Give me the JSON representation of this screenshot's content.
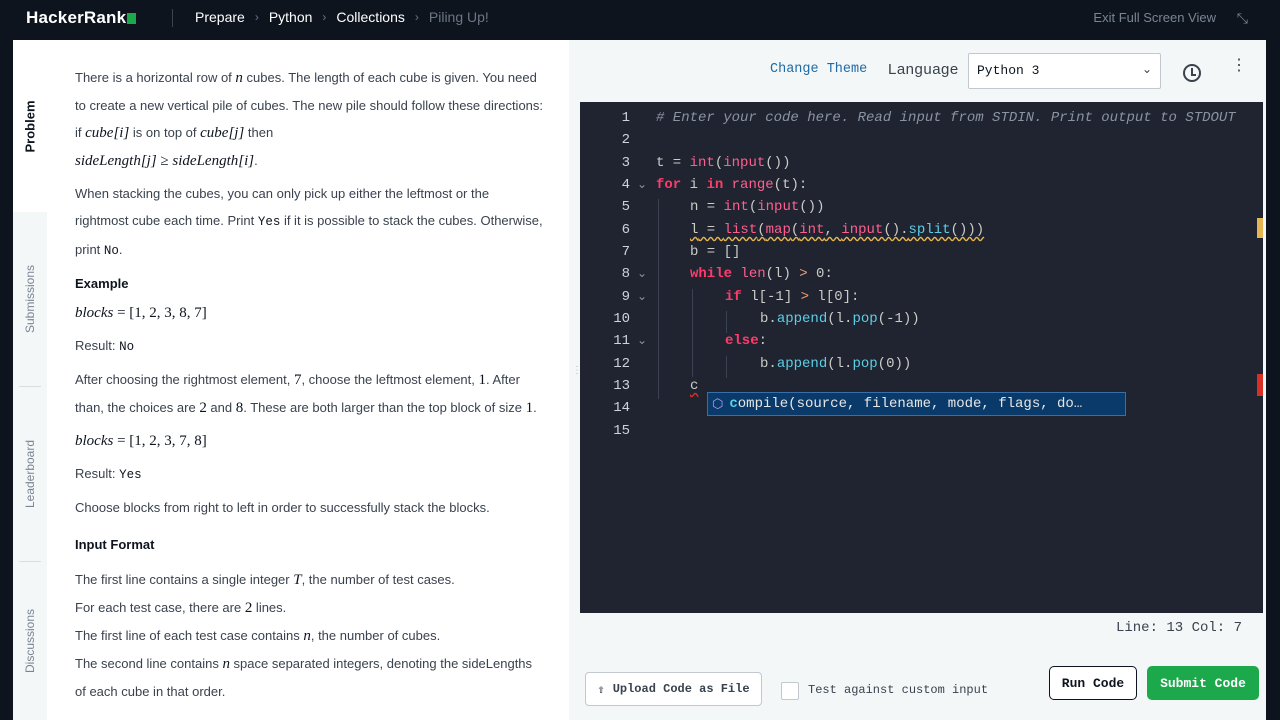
{
  "topbar": {
    "logo": "HackerRank",
    "breadcrumbs": [
      "Prepare",
      "Python",
      "Collections",
      "Piling Up!"
    ],
    "chev": "›",
    "exit_fullscreen": "Exit Full Screen View",
    "exit_icon": "⤡"
  },
  "side_tabs": [
    "Problem",
    "Submissions",
    "Leaderboard",
    "Discussions"
  ],
  "problem": {
    "p1a": "There is a horizontal row of ",
    "p1n": "n",
    "p1b": " cubes. The length of each cube is given. You need to create a new vertical pile of cubes. The new pile should follow these directions: if ",
    "p1c1": "cube[i]",
    "p1c": " is on top of ",
    "p1c2": "cube[j]",
    "p1d": " then",
    "p1math": "sideLength[j] ≥ sideLength[i]",
    "p1e": ".",
    "p2a": "When stacking the cubes, you can only pick up either the leftmost or the rightmost cube each time. Print ",
    "p2yes": "Yes",
    "p2b": " if it is possible to stack the cubes. Otherwise, print ",
    "p2no": "No",
    "p2c": ".",
    "example_heading": "Example",
    "ex1_lhs": "blocks",
    "ex1_rhs": " = [1, 2, 3, 8, 7]",
    "result_label": "Result: ",
    "ex1_result": "No",
    "p3a": "After choosing the rightmost element, ",
    "p3n1": "7",
    "p3b": ", choose the leftmost element, ",
    "p3n2": "1",
    "p3c": ". After than, the choices are ",
    "p3n3": "2",
    "p3d": " and ",
    "p3n4": "8",
    "p3e": ". These are both larger than the top block of size ",
    "p3n5": "1",
    "p3f": ".",
    "ex2_lhs": "blocks",
    "ex2_rhs": " = [1, 2, 3, 7, 8]",
    "ex2_result": "Yes",
    "p4": "Choose blocks from right to left in order to successfully stack the blocks.",
    "input_heading": "Input Format",
    "if1a": "The first line contains a single integer ",
    "if1t": "T",
    "if1b": ", the number of test cases.",
    "if2a": "For each test case, there are ",
    "if2n": "2",
    "if2b": " lines.",
    "if3a": "The first line of each test case contains ",
    "if3n": "n",
    "if3b": ", the number of cubes.",
    "if4a": "The second line contains ",
    "if4n": "n",
    "if4b": " space separated integers, denoting the sideLengths of each cube in that order."
  },
  "editor": {
    "change_theme": "Change Theme",
    "language_label": "Language",
    "language_value": "Python 3",
    "dropdown_icon": "⌄",
    "more_icon": "⋮",
    "line_numbers": [
      "1",
      "2",
      "3",
      "4",
      "5",
      "6",
      "7",
      "8",
      "9",
      "10",
      "11",
      "12",
      "13",
      "14",
      "15"
    ],
    "fold_icon": "⌄",
    "code": {
      "l1": "# Enter your code here. Read input from STDIN. Print output to STDOUT",
      "l3_t": "t",
      "l3_eq": " = ",
      "l3_int": "int",
      "l3_p1": "(",
      "l3_input": "input",
      "l3_p2": "())",
      "l4_for": "for",
      "l4_i": " i ",
      "l4_in": "in",
      "l4_sp": " ",
      "l4_range": "range",
      "l4_rest": "(t):",
      "l5_n": "n",
      "l5_eq": " = ",
      "l5_int": "int",
      "l5_p": "(",
      "l5_input": "input",
      "l5_end": "())",
      "l6_l": "l",
      "l6_eq": " = ",
      "l6_list": "list",
      "l6_p": "(",
      "l6_map": "map",
      "l6_p2": "(",
      "l6_int": "int",
      "l6_c": ", ",
      "l6_input": "input",
      "l6_split": "().",
      "l6_split2": "split",
      "l6_end": "()))",
      "l7": "b = []",
      "l8_while": "while",
      "l8_sp": " ",
      "l8_len": "len",
      "l8_rest": "(l) ",
      "l8_gt": ">",
      "l8_end": " 0:",
      "l9_if": "if",
      "l9_rest": " l[-1] ",
      "l9_gt": ">",
      "l9_end": " l[0]:",
      "l10_b": "b.",
      "l10_append": "append",
      "l10_p": "(l.",
      "l10_pop": "pop",
      "l10_end": "(-1))",
      "l11_else": "else",
      "l11_end": ":",
      "l12_b": "b.",
      "l12_append": "append",
      "l12_p": "(l.",
      "l12_pop": "pop",
      "l12_end": "(0))",
      "l13": "c"
    },
    "autocomplete_icon": "⬡",
    "autocomplete_match": "c",
    "autocomplete_rest": "ompile(source, filename, mode, flags, do…",
    "status": "Line: 13 Col: 7",
    "upload_icon": "⇧",
    "upload": "Upload Code as File",
    "custom_input": "Test against custom input",
    "run": "Run Code",
    "submit": "Submit Code",
    "drag_handle": "⋮"
  },
  "colors": {
    "brand_green": "#1ba94c",
    "topbar_bg": "#0e141e",
    "editor_bg": "#1f2430"
  }
}
